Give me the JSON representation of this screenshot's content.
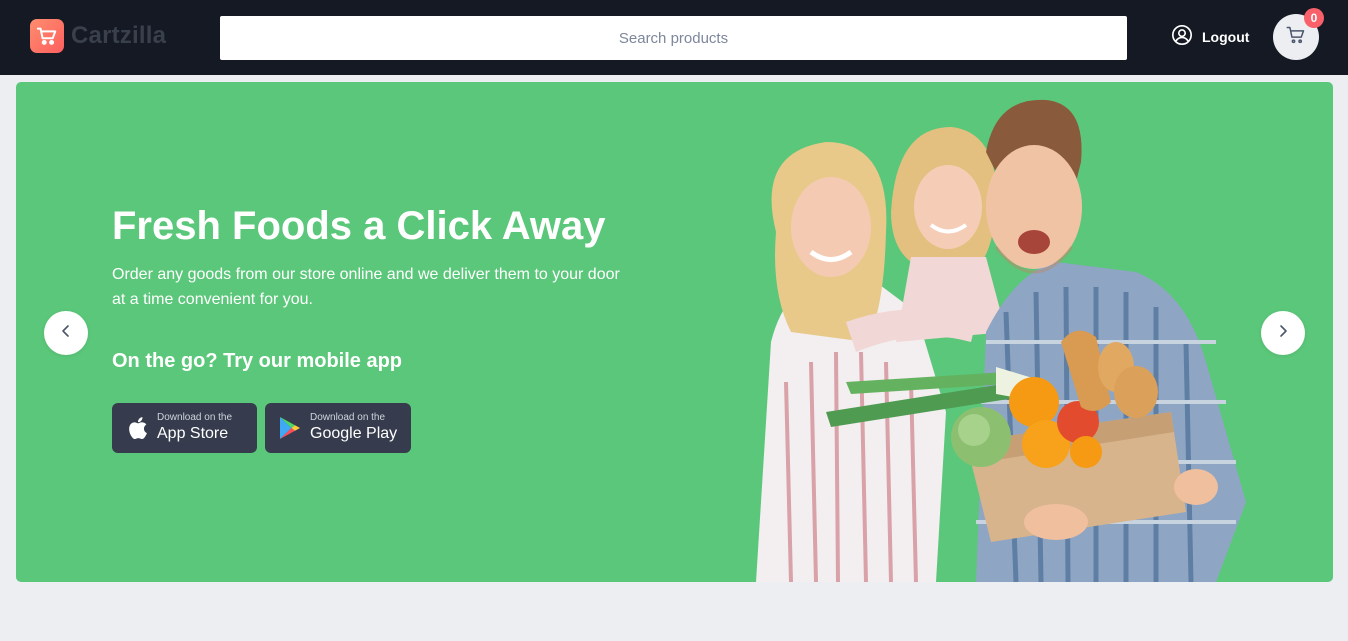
{
  "header": {
    "logo_text": "Cartzilla",
    "search_placeholder": "Search products",
    "logout_label": "Logout",
    "cart_count": "0"
  },
  "hero": {
    "title": "Fresh Foods a Click Away",
    "description": "Order any goods from our store online and we deliver them to your door at a time convenient for you.",
    "app_heading": "On the go? Try our mobile app",
    "app_store": {
      "small": "Download on the",
      "big": "App Store"
    },
    "google_play": {
      "small": "Download on the",
      "big": "Google Play"
    }
  },
  "colors": {
    "header_bg": "#141923",
    "hero_bg": "#5bc77a",
    "accent": "#fe6a6a",
    "page_bg": "#eceef1"
  },
  "icons": {
    "logo": "cart-logo-icon",
    "user": "user-circle-icon",
    "cart": "cart-icon",
    "prev": "chevron-left-icon",
    "next": "chevron-right-icon",
    "apple": "apple-icon",
    "google_play": "google-play-icon"
  }
}
